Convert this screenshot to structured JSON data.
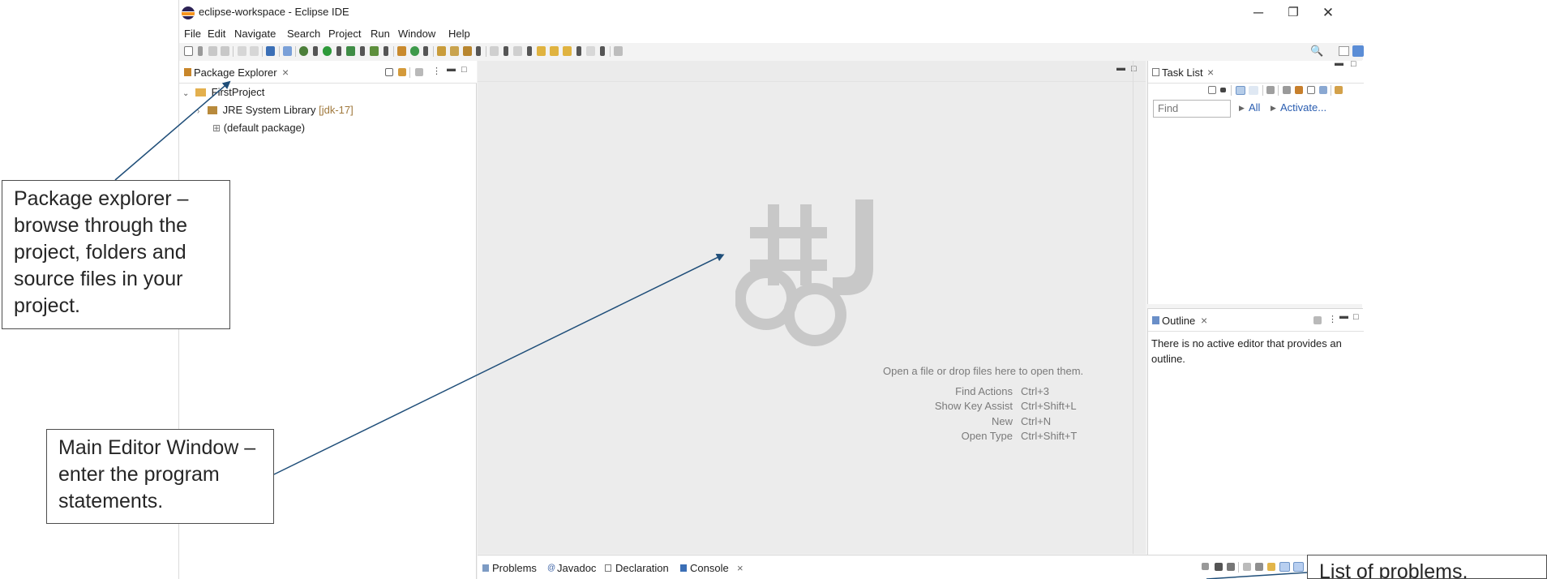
{
  "window": {
    "title": "eclipse-workspace - Eclipse IDE",
    "controls": {
      "minimize": "─",
      "restore": "❐",
      "close": "✕"
    }
  },
  "menu": [
    "File",
    "Edit",
    "Navigate",
    "Search",
    "Project",
    "Run",
    "Window",
    "Help"
  ],
  "toolbar": {
    "search_icon": "🔍"
  },
  "package_explorer": {
    "tab_label": "Package Explorer",
    "close": "×",
    "tree": {
      "project": "FirstProject",
      "library": "JRE System Library",
      "library_decoration": "[jdk-17]",
      "package": "(default package)"
    }
  },
  "editor": {
    "drop_hint": "Open a file or drop files here to open them.",
    "shortcuts": [
      {
        "action": "Find Actions",
        "key": "Ctrl+3"
      },
      {
        "action": "Show Key Assist",
        "key": "Ctrl+Shift+L"
      },
      {
        "action": "New",
        "key": "Ctrl+N"
      },
      {
        "action": "Open Type",
        "key": "Ctrl+Shift+T"
      }
    ]
  },
  "task_list": {
    "tab_label": "Task List",
    "close": "×",
    "find_placeholder": "Find",
    "filter_all": "All",
    "activate": "Activate..."
  },
  "outline": {
    "tab_label": "Outline",
    "close": "×",
    "message": "There is no active editor that provides an outline."
  },
  "bottom_panel": {
    "tabs": [
      "Problems",
      "Javadoc",
      "Declaration",
      "Console"
    ],
    "close": "×"
  },
  "callouts": {
    "package_explorer": "Package explorer – browse through the project, folders and source files in your project.",
    "editor": "Main Editor Window – enter the program statements.",
    "problems": "List of problems,"
  },
  "colors": {
    "callout_arrow": "#1f4e79",
    "link": "#2a5db0",
    "library_decoration": "#a0793d",
    "editor_background": "#ececec"
  }
}
